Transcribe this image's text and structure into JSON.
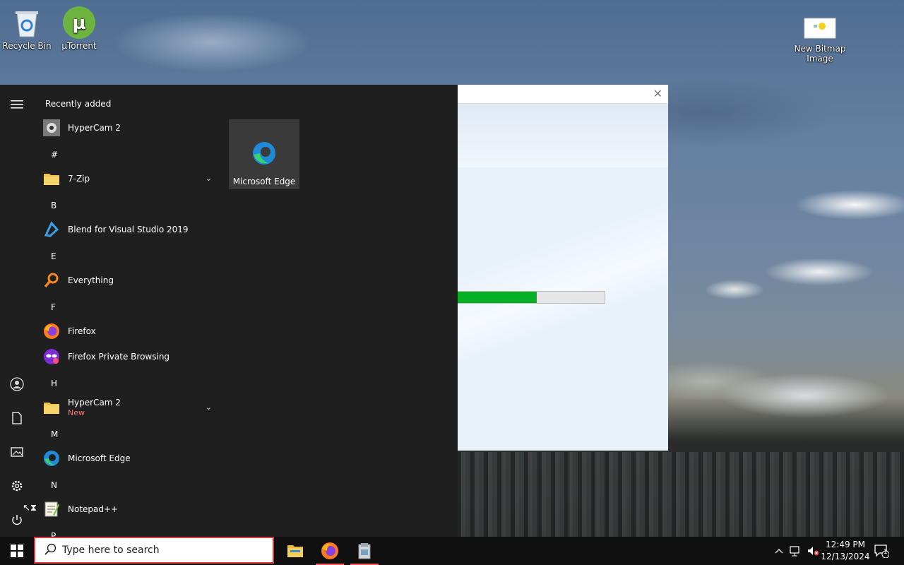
{
  "desktop": {
    "icons": [
      {
        "label": "Recycle Bin",
        "icon": "recycle-bin-icon"
      },
      {
        "label": "µTorrent",
        "icon": "utorrent-icon"
      },
      {
        "label": "New Bitmap Image",
        "icon": "bitmap-file-icon"
      }
    ]
  },
  "background_window": {
    "progress_fraction": 0.54,
    "progress_color": "#06b025"
  },
  "start_menu": {
    "recently_added_header": "Recently added",
    "recent_app": {
      "label": "HyperCam 2",
      "icon": "hypercam-icon"
    },
    "groups": {
      "hash": "#",
      "b": "B",
      "e": "E",
      "f": "F",
      "h": "H",
      "m": "M",
      "n": "N",
      "p": "P"
    },
    "apps": {
      "seven_zip": {
        "label": "7-Zip",
        "icon": "folder-icon"
      },
      "blend": {
        "label": "Blend for Visual Studio 2019",
        "icon": "blend-icon"
      },
      "everything": {
        "label": "Everything",
        "icon": "magnifier-icon"
      },
      "firefox": {
        "label": "Firefox",
        "icon": "firefox-icon"
      },
      "firefox_private": {
        "label": "Firefox Private Browsing",
        "icon": "private-mask-icon"
      },
      "hypercam_folder": {
        "label": "HyperCam 2",
        "badge": "New",
        "icon": "folder-icon"
      },
      "edge": {
        "label": "Microsoft Edge",
        "icon": "edge-icon"
      },
      "notepadpp": {
        "label": "Notepad++",
        "icon": "notepadpp-icon"
      }
    },
    "tile": {
      "label": "Microsoft Edge",
      "icon": "edge-icon"
    },
    "rail": [
      "hamburger-icon",
      "user-icon",
      "documents-icon",
      "pictures-icon",
      "settings-icon",
      "power-icon"
    ]
  },
  "taskbar": {
    "search_placeholder": "Type here to search",
    "pinned": [
      "file-explorer-icon",
      "firefox-icon",
      "installer-icon"
    ],
    "clock_time": "12:49 PM",
    "clock_date": "12/13/2024",
    "notification_count": "1"
  }
}
